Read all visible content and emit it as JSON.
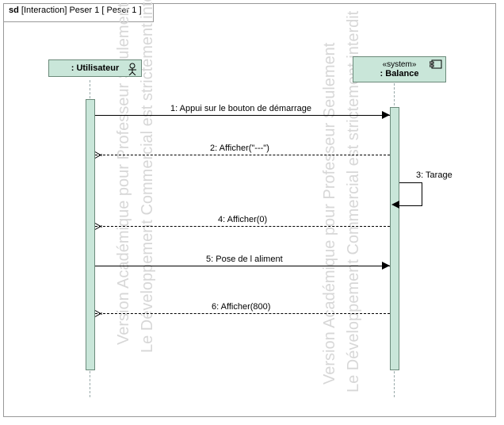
{
  "frame": {
    "kind": "sd",
    "title": "[Interaction] Peser 1 [ Peser 1 ]"
  },
  "lifelines": {
    "user": {
      "stereotype": "",
      "role": ": Utilisateur",
      "icon": "actor"
    },
    "system": {
      "stereotype": "«system»",
      "role": ": Balance",
      "icon": "component"
    }
  },
  "messages": [
    {
      "n": "1",
      "text": "Appui sur le bouton de démarrage",
      "from": "user",
      "to": "system",
      "style": "solid"
    },
    {
      "n": "2",
      "text": "Afficher(\"---\")",
      "from": "system",
      "to": "user",
      "style": "dashed"
    },
    {
      "n": "3",
      "text": "Tarage",
      "from": "system",
      "to": "system",
      "style": "solid"
    },
    {
      "n": "4",
      "text": "Afficher(0)",
      "from": "system",
      "to": "user",
      "style": "dashed"
    },
    {
      "n": "5",
      "text": "Pose de l aliment",
      "from": "user",
      "to": "system",
      "style": "solid"
    },
    {
      "n": "6",
      "text": "Afficher(800)",
      "from": "system",
      "to": "user",
      "style": "dashed"
    }
  ],
  "watermarks": [
    "Version Académique pour Professeur Seulement",
    "Le Développement Commercial est strictement interdit"
  ]
}
